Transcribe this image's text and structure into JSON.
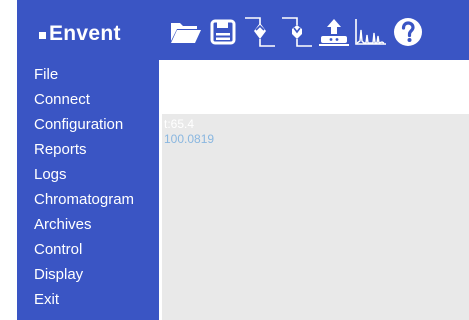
{
  "app": {
    "brand": "Envent",
    "colors": {
      "brand_blue": "#3a55c4",
      "menu_text": "#ffffff",
      "panel_gray": "#e9e9e9",
      "readout_1": "#ffffff",
      "readout_2": "#8ab7e0"
    }
  },
  "toolbar": {
    "buttons": [
      {
        "icon": "folder-open-icon"
      },
      {
        "icon": "save-disk-icon"
      },
      {
        "icon": "upload-to-device-icon"
      },
      {
        "icon": "download-from-device-icon"
      },
      {
        "icon": "upload-network-icon"
      },
      {
        "icon": "chromatogram-icon"
      },
      {
        "icon": "help-icon"
      }
    ]
  },
  "menu": {
    "items": [
      {
        "label": "File"
      },
      {
        "label": "Connect"
      },
      {
        "label": "Configuration"
      },
      {
        "label": "Reports"
      },
      {
        "label": "Logs"
      },
      {
        "label": "Chromatogram"
      },
      {
        "label": "Archives"
      },
      {
        "label": "Control"
      },
      {
        "label": "Display"
      },
      {
        "label": "Exit"
      }
    ]
  },
  "readouts": {
    "line1": "t:65.4",
    "line2": "100.0819"
  }
}
